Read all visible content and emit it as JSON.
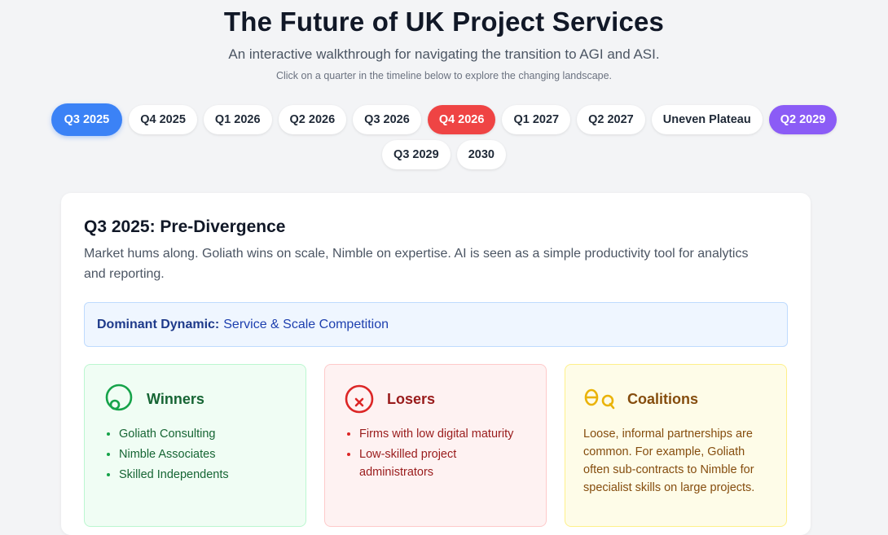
{
  "header": {
    "title": "The Future of UK Project Services",
    "subtitle": "An interactive walkthrough for navigating the transition to AGI and ASI.",
    "instruction": "Click on a quarter in the timeline below to explore the changing landscape."
  },
  "timeline": [
    {
      "label": "Q3 2025",
      "state": "active",
      "color": "#3b82f6"
    },
    {
      "label": "Q4 2025",
      "state": "default"
    },
    {
      "label": "Q1 2026",
      "state": "default"
    },
    {
      "label": "Q2 2026",
      "state": "default"
    },
    {
      "label": "Q3 2026",
      "state": "default"
    },
    {
      "label": "Q4 2026",
      "state": "highlight",
      "color": "#ef4444"
    },
    {
      "label": "Q1 2027",
      "state": "default"
    },
    {
      "label": "Q2 2027",
      "state": "default"
    },
    {
      "label": "Uneven Plateau",
      "state": "default"
    },
    {
      "label": "Q2 2029",
      "state": "highlight",
      "color": "#8b5cf6"
    },
    {
      "label": "Q3 2029",
      "state": "default"
    },
    {
      "label": "2030",
      "state": "default"
    }
  ],
  "detail": {
    "title": "Q3 2025: Pre-Divergence",
    "description": "Market hums along. Goliath wins on scale, Nimble on expertise. AI is seen as a simple productivity tool for analytics and reporting.",
    "dynamic_label": "Dominant Dynamic:",
    "dynamic_value": "Service & Scale Competition",
    "winners": {
      "title": "Winners",
      "icon": "trophy-icon",
      "items": [
        "Goliath Consulting",
        "Nimble Associates",
        "Skilled Independents"
      ]
    },
    "losers": {
      "title": "Losers",
      "icon": "x-circle-icon",
      "items": [
        "Firms with low digital maturity",
        "Low-skilled project administrators"
      ]
    },
    "coalitions": {
      "title": "Coalitions",
      "icon": "link-icon",
      "text": "Loose, informal partnerships are common. For example, Goliath often sub-contracts to Nimble for specialist skills on large projects."
    }
  },
  "colors": {
    "accent": "#3b82f6",
    "winners": "#16a34a",
    "losers": "#dc2626",
    "coalitions": "#eab308"
  }
}
